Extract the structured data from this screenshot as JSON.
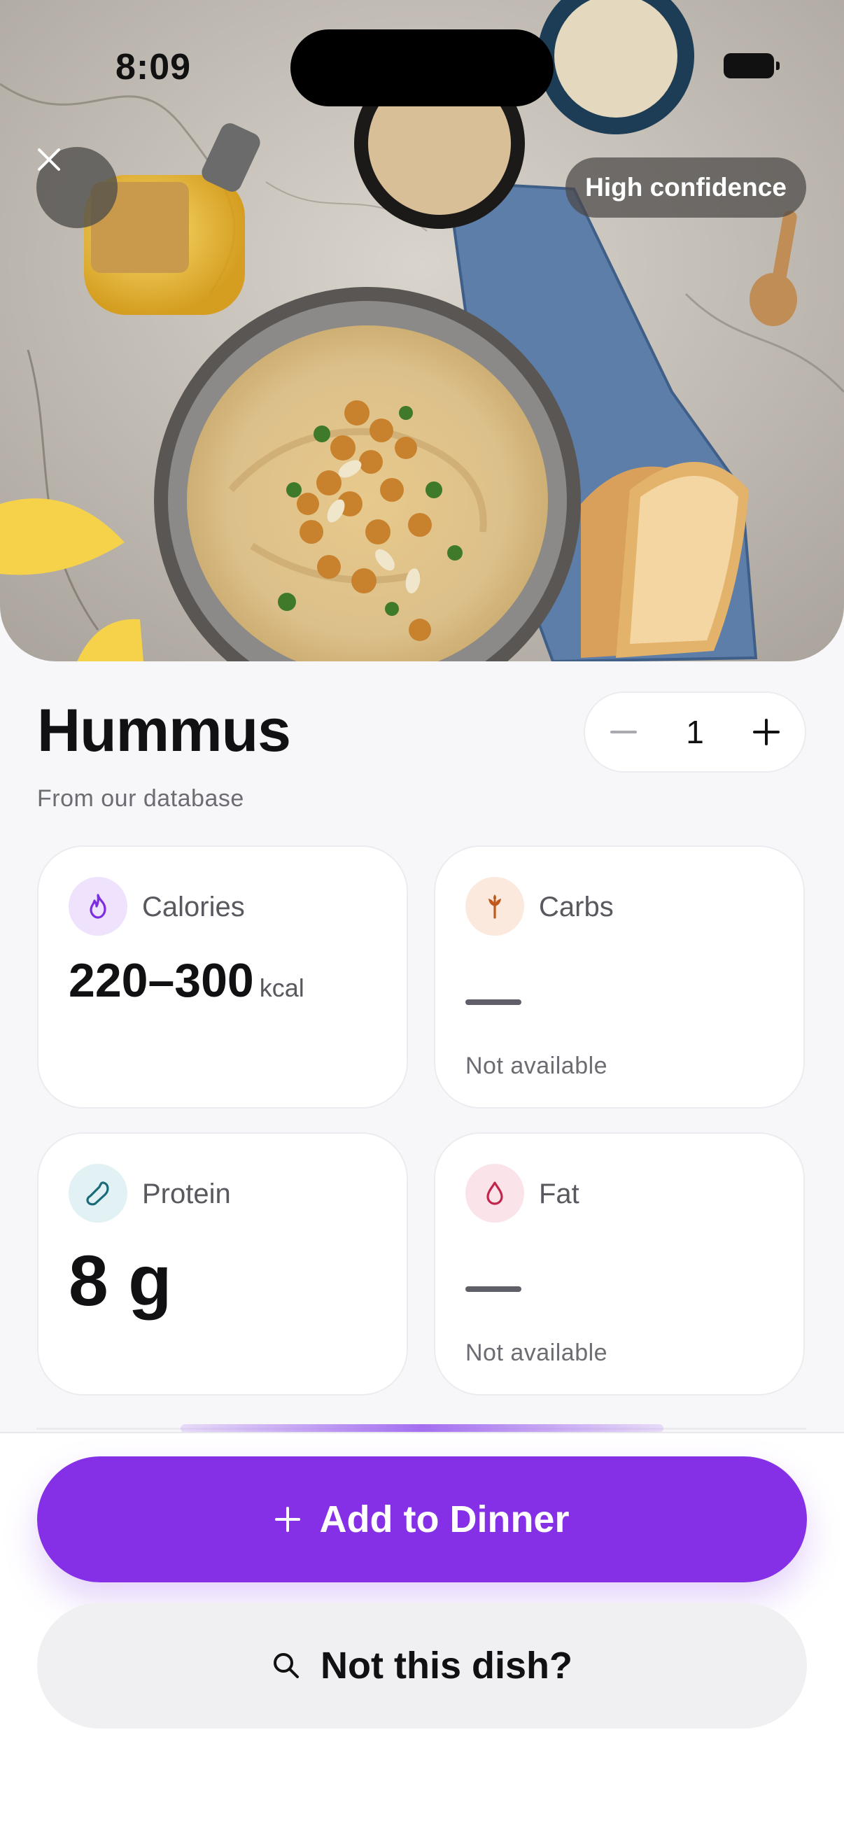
{
  "status_bar": {
    "time": "8:09"
  },
  "photo": {
    "confidence_badge": "High confidence"
  },
  "dish": {
    "name": "Hummus",
    "source": "From our database",
    "quantity": "1"
  },
  "nutrients": {
    "calories": {
      "label": "Calories",
      "value": "220–300",
      "unit": "kcal"
    },
    "carbs": {
      "label": "Carbs",
      "status": "Not available"
    },
    "protein": {
      "label": "Protein",
      "value": "8 g"
    },
    "fat": {
      "label": "Fat",
      "status": "Not available"
    }
  },
  "actions": {
    "add_label": "Add to Dinner",
    "alt_label": "Not this dish?"
  },
  "colors": {
    "accent": "#8530e6",
    "calories_icon": "#7a2ee0",
    "carbs_icon": "#c0591b",
    "protein_icon": "#1a6b7a",
    "fat_icon": "#c2254c"
  },
  "icons": {
    "close": "close-icon",
    "calories": "flame-icon",
    "carbs": "wheat-icon",
    "protein": "drumstick-icon",
    "fat": "drop-icon",
    "add": "plus-icon",
    "search": "search-icon"
  }
}
